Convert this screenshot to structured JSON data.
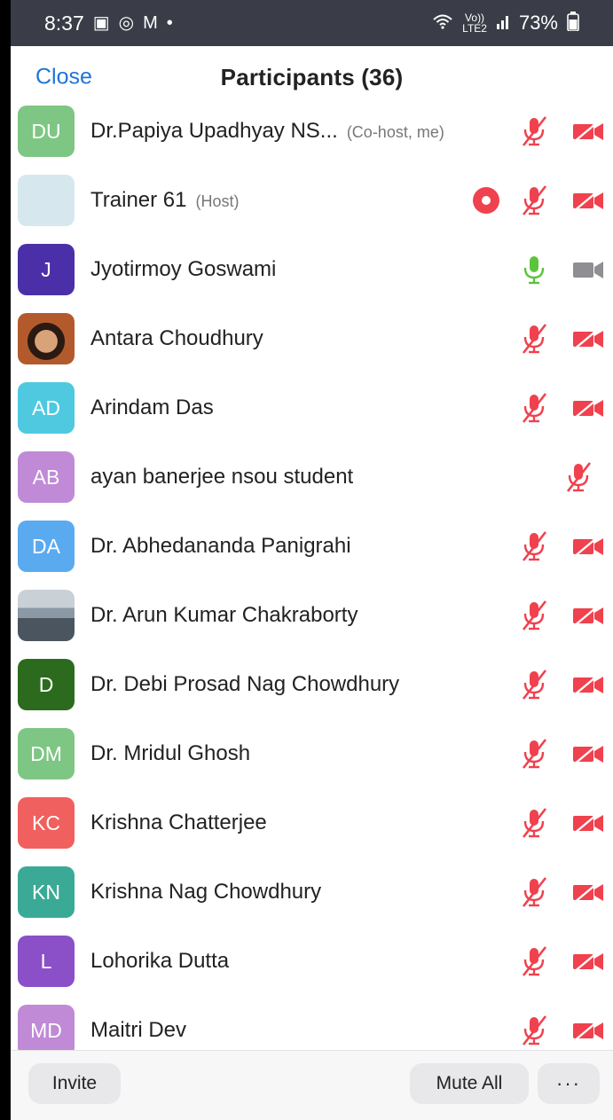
{
  "status_bar": {
    "time": "8:37",
    "network_label": "Vo))",
    "network_sub": "LTE2",
    "battery": "73%"
  },
  "header": {
    "close_label": "Close",
    "title": "Participants (36)"
  },
  "participants": [
    {
      "initials": "DU",
      "name": "Dr.Papiya Upadhyay NS...",
      "role": "(Co-host, me)",
      "avatar_color": "#7ec683",
      "recording": false,
      "mic": "muted",
      "video": "off"
    },
    {
      "initials": "",
      "name": "Trainer 61",
      "role": "(Host)",
      "avatar_color": "#d6e8ee",
      "recording": true,
      "mic": "muted",
      "video": "off"
    },
    {
      "initials": "J",
      "name": "Jyotirmoy Goswami",
      "role": "",
      "avatar_color": "#4b2fa8",
      "recording": false,
      "mic": "active",
      "video": "on"
    },
    {
      "initials": "",
      "name": "Antara Choudhury",
      "role": "",
      "avatar_color": "#b35a2c",
      "photo": "photo-1",
      "recording": false,
      "mic": "muted",
      "video": "off"
    },
    {
      "initials": "AD",
      "name": "Arindam Das",
      "role": "",
      "avatar_color": "#4ec9e0",
      "recording": false,
      "mic": "muted",
      "video": "off"
    },
    {
      "initials": "AB",
      "name": "ayan banerjee nsou student",
      "role": "",
      "avatar_color": "#c08ad6",
      "recording": false,
      "mic": "muted",
      "video": "none"
    },
    {
      "initials": "DA",
      "name": "Dr. Abhedananda Panigrahi",
      "role": "",
      "avatar_color": "#5aaaf0",
      "recording": false,
      "mic": "muted",
      "video": "off"
    },
    {
      "initials": "",
      "name": "Dr. Arun Kumar Chakraborty",
      "role": "",
      "avatar_color": "#8b99a6",
      "photo": "photo-2",
      "recording": false,
      "mic": "muted",
      "video": "off"
    },
    {
      "initials": "D",
      "name": "Dr. Debi Prosad Nag Chowdhury",
      "role": "",
      "avatar_color": "#2c6b1e",
      "recording": false,
      "mic": "muted",
      "video": "off"
    },
    {
      "initials": "DM",
      "name": "Dr. Mridul Ghosh",
      "role": "",
      "avatar_color": "#7ec683",
      "recording": false,
      "mic": "muted",
      "video": "off"
    },
    {
      "initials": "KC",
      "name": "Krishna Chatterjee",
      "role": "",
      "avatar_color": "#f0605e",
      "recording": false,
      "mic": "muted",
      "video": "off"
    },
    {
      "initials": "KN",
      "name": "Krishna Nag Chowdhury",
      "role": "",
      "avatar_color": "#3aaa96",
      "recording": false,
      "mic": "muted",
      "video": "off"
    },
    {
      "initials": "L",
      "name": "Lohorika Dutta",
      "role": "",
      "avatar_color": "#8b4fc8",
      "recording": false,
      "mic": "muted",
      "video": "off"
    },
    {
      "initials": "MD",
      "name": "Maitri Dev",
      "role": "",
      "avatar_color": "#c08ad6",
      "recording": false,
      "mic": "muted",
      "video": "off"
    }
  ],
  "bottom_bar": {
    "invite_label": "Invite",
    "mute_all_label": "Mute All",
    "more_label": "···"
  },
  "colors": {
    "accent": "#1f74d6",
    "muted_red": "#f0414e",
    "mic_active": "#5cc43c",
    "video_on": "#8e8e93"
  }
}
